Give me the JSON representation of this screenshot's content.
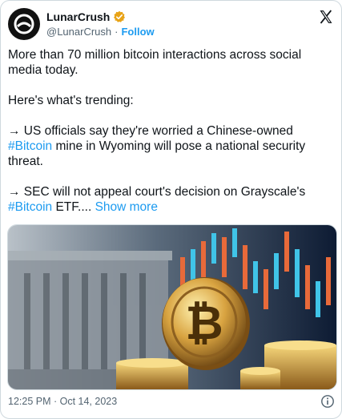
{
  "author": {
    "name": "LunarCrush",
    "handle": "@LunarCrush",
    "separator": "·",
    "follow_label": "Follow"
  },
  "tweet": {
    "line1": "More than 70 million bitcoin interactions across social media today.",
    "line2": "Here's what's trending:",
    "item1_prefix": "→ US officials say they're worried a Chinese-owned ",
    "item1_tag": "#Bitcoin",
    "item1_suffix": " mine in Wyoming will pose a national security threat.",
    "item2_prefix": "→ SEC will not appeal court's decision on Grayscale's ",
    "item2_tag": "#Bitcoin",
    "item2_suffix": " ETF....",
    "show_more": "Show more"
  },
  "footer": {
    "timestamp": "12:25 PM · Oct 14, 2023"
  },
  "icons": {
    "brand": "x-logo-icon",
    "verified": "verified-badge-icon",
    "info": "info-icon"
  },
  "colors": {
    "link": "#1d9bf0",
    "verified": "#e8a317",
    "text": "#0f1419",
    "muted": "#536471"
  }
}
